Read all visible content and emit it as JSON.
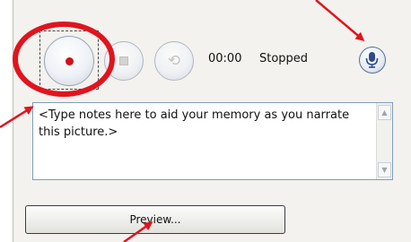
{
  "recorder": {
    "time": "00:00",
    "status": "Stopped"
  },
  "notes": {
    "text": "<Type notes here to aid your memory as you narrate this picture.>"
  },
  "preview": {
    "label": "Preview..."
  },
  "icons": {
    "record": "record-dot-icon",
    "stop": "stop-square-icon",
    "play": "replay-icon",
    "microphone": "microphone-icon",
    "scroll_up": "chevron-up-icon",
    "scroll_down": "chevron-down-icon"
  },
  "colors": {
    "annotation_red": "#e0141e",
    "record_dot": "#d0101a",
    "panel_bg": "#f3f2ee"
  }
}
